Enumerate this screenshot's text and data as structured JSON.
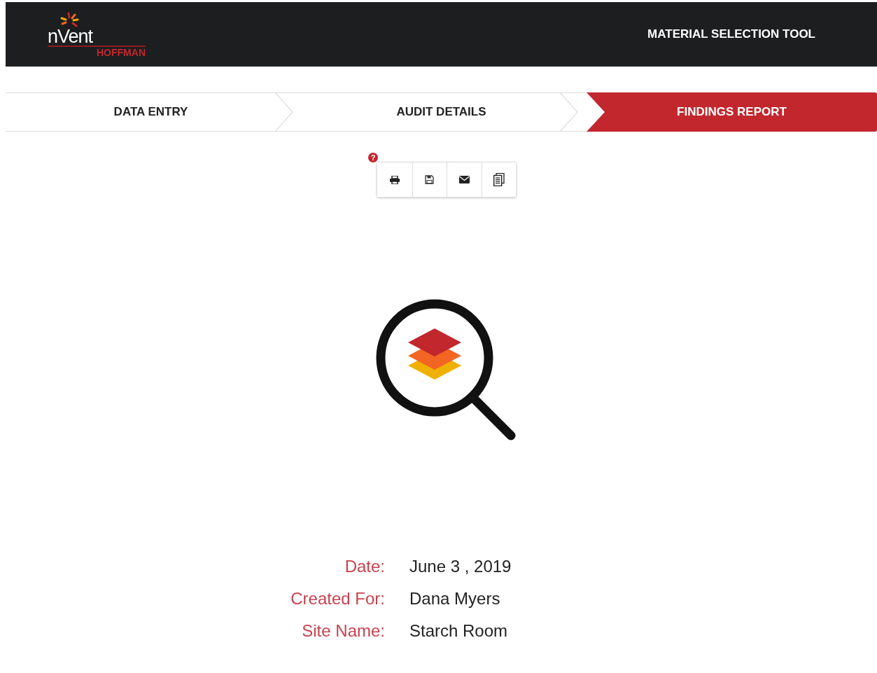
{
  "header": {
    "logo": {
      "brand": "nVent",
      "sub_brand": "HOFFMAN"
    },
    "title": "MATERIAL SELECTION TOOL"
  },
  "steps": [
    {
      "label": "DATA ENTRY",
      "selected": false
    },
    {
      "label": "AUDIT DETAILS",
      "selected": false
    },
    {
      "label": "FINDINGS REPORT",
      "selected": true
    }
  ],
  "toolbar": {
    "help": "?",
    "buttons": [
      {
        "kind": "print"
      },
      {
        "kind": "save"
      },
      {
        "kind": "email"
      },
      {
        "kind": "copy"
      }
    ]
  },
  "details": [
    {
      "label": "Date:",
      "value": "June 3 , 2019"
    },
    {
      "label": "Created For:",
      "value": "Dana Myers"
    },
    {
      "label": "Site Name:",
      "value": "Starch Room"
    }
  ]
}
